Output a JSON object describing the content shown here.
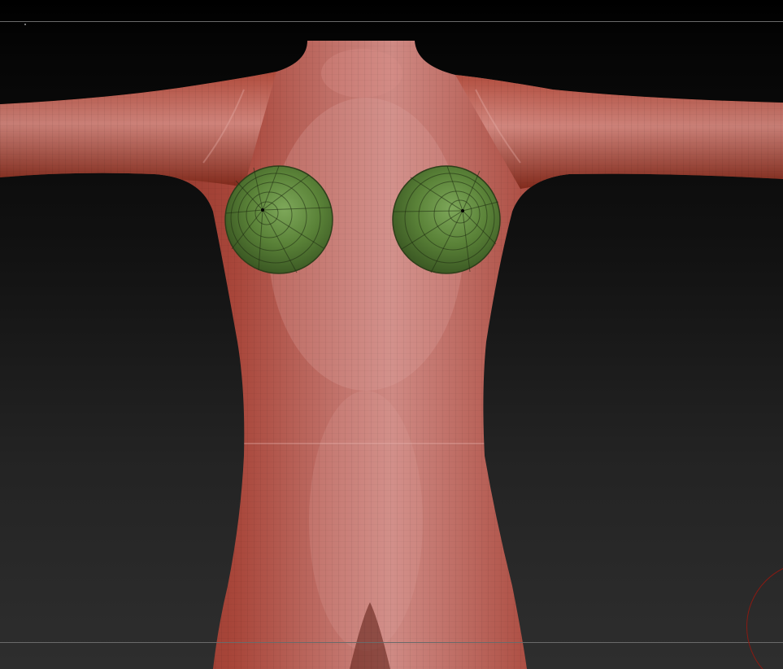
{
  "canvas": {
    "type": "3d-viewport",
    "background_top": "#000000",
    "background_bottom": "#2e2e2e"
  },
  "model": {
    "subject": "mannequin-torso",
    "base_material_color": "#b5473a",
    "highlight_color": "#d9908a",
    "wireframe": true
  },
  "masked_polygroups": {
    "color": "#5d8a3a",
    "count": 2
  },
  "guides": {
    "color": "#6a6a6a"
  },
  "brush": {
    "cursor_color": "#8a1a12"
  }
}
